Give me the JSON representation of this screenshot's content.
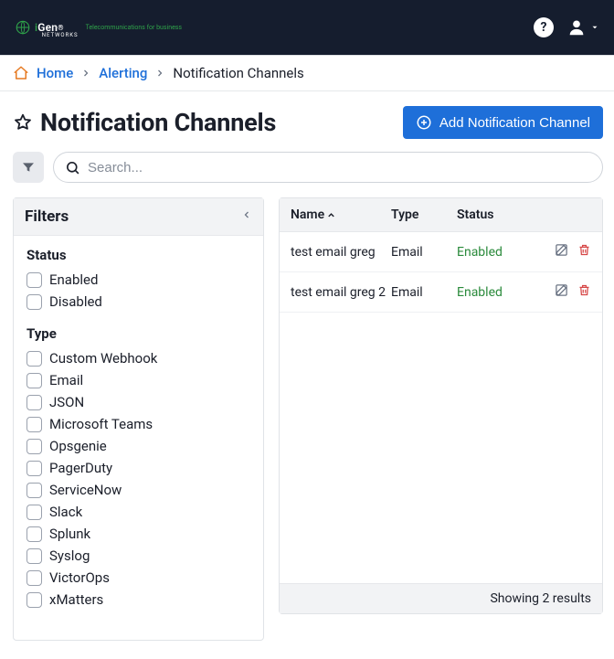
{
  "brand": {
    "name_fragment_1": "Gen",
    "reg": "®",
    "sub": "NETWORKS",
    "tag": "Telecommunications for business"
  },
  "breadcrumb": {
    "home": "Home",
    "alerting": "Alerting",
    "current": "Notification Channels"
  },
  "title": "Notification Channels",
  "primary_button": "Add Notification Channel",
  "search": {
    "placeholder": "Search..."
  },
  "filters": {
    "title": "Filters",
    "groups": [
      {
        "label": "Status",
        "items": [
          "Enabled",
          "Disabled"
        ]
      },
      {
        "label": "Type",
        "items": [
          "Custom Webhook",
          "Email",
          "JSON",
          "Microsoft Teams",
          "Opsgenie",
          "PagerDuty",
          "ServiceNow",
          "Slack",
          "Splunk",
          "Syslog",
          "VictorOps",
          "xMatters"
        ]
      }
    ]
  },
  "table": {
    "columns": {
      "name": "Name",
      "type": "Type",
      "status": "Status"
    },
    "rows": [
      {
        "name": "test email greg",
        "type": "Email",
        "status": "Enabled"
      },
      {
        "name": "test email greg 2",
        "type": "Email",
        "status": "Enabled"
      }
    ],
    "footer": "Showing 2 results"
  }
}
